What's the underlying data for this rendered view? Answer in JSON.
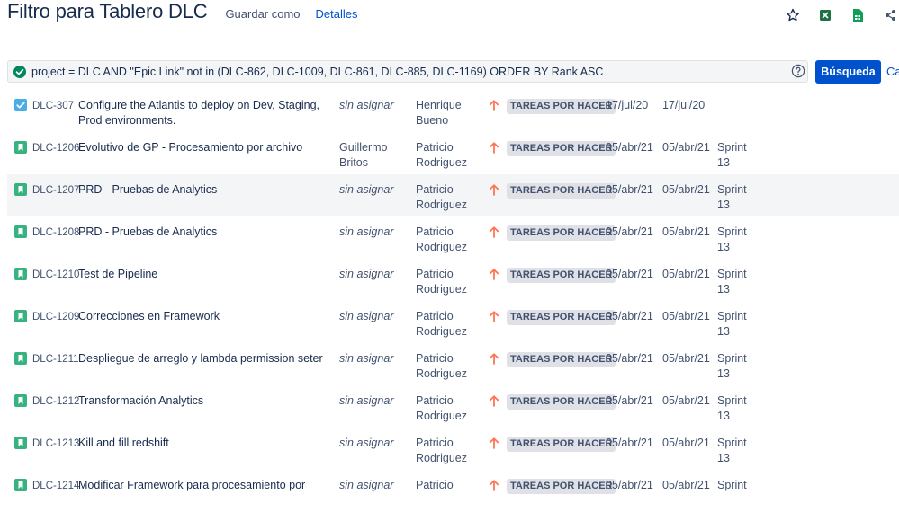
{
  "header": {
    "title": "Filtro para Tablero DLC",
    "save_as": "Guardar como",
    "details": "Detalles"
  },
  "top_icons": [
    "star-icon",
    "excel-export-icon",
    "sheets-export-icon",
    "share-icon"
  ],
  "query": {
    "text": "project = DLC AND \"Epic Link\" not in (DLC-862, DLC-1009, DLC-861, DLC-885, DLC-1169) ORDER BY Rank ASC",
    "search_button": "Búsqueda",
    "cancel_link": "Ca"
  },
  "issues": [
    {
      "type": "task",
      "key": "DLC-307",
      "summary": "Configure the Atlantis to deploy on Dev, Staging, Prod environments.",
      "assignee": "sin asignar",
      "unassigned": true,
      "reporter": "Henrique Bueno",
      "status": "TAREAS POR HACER",
      "created": "17/jul/20",
      "updated": "17/jul/20",
      "sprint": ""
    },
    {
      "type": "story",
      "key": "DLC-1206",
      "summary": "Evolutivo de GP - Procesamiento por archivo",
      "assignee": "Guillermo Britos",
      "unassigned": false,
      "reporter": "Patricio Rodriguez",
      "status": "TAREAS POR HACER",
      "created": "05/abr/21",
      "updated": "05/abr/21",
      "sprint": "Sprint 13"
    },
    {
      "type": "story",
      "key": "DLC-1207",
      "summary": "PRD - Pruebas de Analytics",
      "assignee": "sin asignar",
      "unassigned": true,
      "reporter": "Patricio Rodriguez",
      "status": "TAREAS POR HACER",
      "created": "05/abr/21",
      "updated": "05/abr/21",
      "sprint": "Sprint 13"
    },
    {
      "type": "story",
      "key": "DLC-1208",
      "summary": "PRD - Pruebas de Analytics",
      "assignee": "sin asignar",
      "unassigned": true,
      "reporter": "Patricio Rodriguez",
      "status": "TAREAS POR HACER",
      "created": "05/abr/21",
      "updated": "05/abr/21",
      "sprint": "Sprint 13"
    },
    {
      "type": "story",
      "key": "DLC-1210",
      "summary": "Test de Pipeline",
      "assignee": "sin asignar",
      "unassigned": true,
      "reporter": "Patricio Rodriguez",
      "status": "TAREAS POR HACER",
      "created": "05/abr/21",
      "updated": "05/abr/21",
      "sprint": "Sprint 13"
    },
    {
      "type": "story",
      "key": "DLC-1209",
      "summary": "Correcciones en Framework",
      "assignee": "sin asignar",
      "unassigned": true,
      "reporter": "Patricio Rodriguez",
      "status": "TAREAS POR HACER",
      "created": "05/abr/21",
      "updated": "05/abr/21",
      "sprint": "Sprint 13"
    },
    {
      "type": "story",
      "key": "DLC-1211",
      "summary": "Despliegue de arreglo y lambda permission seter",
      "assignee": "sin asignar",
      "unassigned": true,
      "reporter": "Patricio Rodriguez",
      "status": "TAREAS POR HACER",
      "created": "05/abr/21",
      "updated": "05/abr/21",
      "sprint": "Sprint 13"
    },
    {
      "type": "story",
      "key": "DLC-1212",
      "summary": "Transformación Analytics",
      "assignee": "sin asignar",
      "unassigned": true,
      "reporter": "Patricio Rodriguez",
      "status": "TAREAS POR HACER",
      "created": "05/abr/21",
      "updated": "05/abr/21",
      "sprint": "Sprint 13"
    },
    {
      "type": "story",
      "key": "DLC-1213",
      "summary": "Kill and fill redshift",
      "assignee": "sin asignar",
      "unassigned": true,
      "reporter": "Patricio Rodriguez",
      "status": "TAREAS POR HACER",
      "created": "05/abr/21",
      "updated": "05/abr/21",
      "sprint": "Sprint 13"
    },
    {
      "type": "story",
      "key": "DLC-1214",
      "summary": "Modificar Framework para procesamiento por",
      "assignee": "sin asignar",
      "unassigned": true,
      "reporter": "Patricio",
      "status": "TAREAS POR HACER",
      "created": "05/abr/21",
      "updated": "05/abr/21",
      "sprint": "Sprint"
    }
  ],
  "highlighted_row_index": 2,
  "colors": {
    "accent": "#0052cc",
    "story": "#36b37e",
    "task": "#4bade8",
    "priority": "#ff7452",
    "lozenge_bg": "#dfe1e6"
  }
}
